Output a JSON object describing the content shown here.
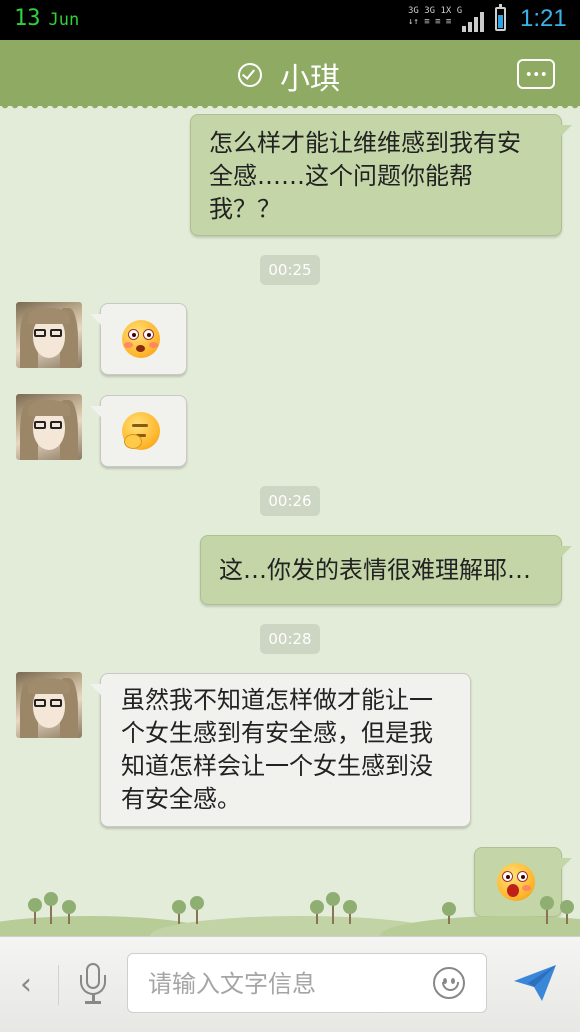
{
  "status_bar": {
    "date_day": "13",
    "date_month": "Jun",
    "network_line1": "3G 3G 1X G",
    "network_line2": "↓↑ ≡ ≡ ≡",
    "battery_level": 0.65,
    "time": "1:21"
  },
  "header": {
    "title": "小琪",
    "status_icon": "check-circle-icon",
    "menu_icon": "more-dots-icon"
  },
  "messages": [
    {
      "type": "text",
      "side": "out",
      "text": "怎么样才能让维维感到我有安全感……这个问题你能帮我？？"
    },
    {
      "type": "timestamp",
      "text": "00:25"
    },
    {
      "type": "emoji",
      "side": "in",
      "emoji": "shocked-face-icon"
    },
    {
      "type": "emoji",
      "side": "in",
      "emoji": "thinking-face-icon"
    },
    {
      "type": "timestamp",
      "text": "00:26"
    },
    {
      "type": "text",
      "side": "out",
      "text": "这…你发的表情很难理解耶…"
    },
    {
      "type": "timestamp",
      "text": "00:28"
    },
    {
      "type": "text",
      "side": "in",
      "text": "虽然我不知道怎样做才能让一个女生感到有安全感，但是我知道怎样会让一个女生感到没有安全感。"
    },
    {
      "type": "emoji",
      "side": "out",
      "emoji": "surprised-face-icon"
    }
  ],
  "input_bar": {
    "back_label": "‹",
    "placeholder": "请输入文字信息",
    "value": ""
  },
  "colors": {
    "header": "#8fab63",
    "outgoing_bubble": "#c4d6a7",
    "incoming_bubble": "#f1f1ee",
    "background": "#e3ecd8",
    "send_icon": "#3a86d8"
  }
}
